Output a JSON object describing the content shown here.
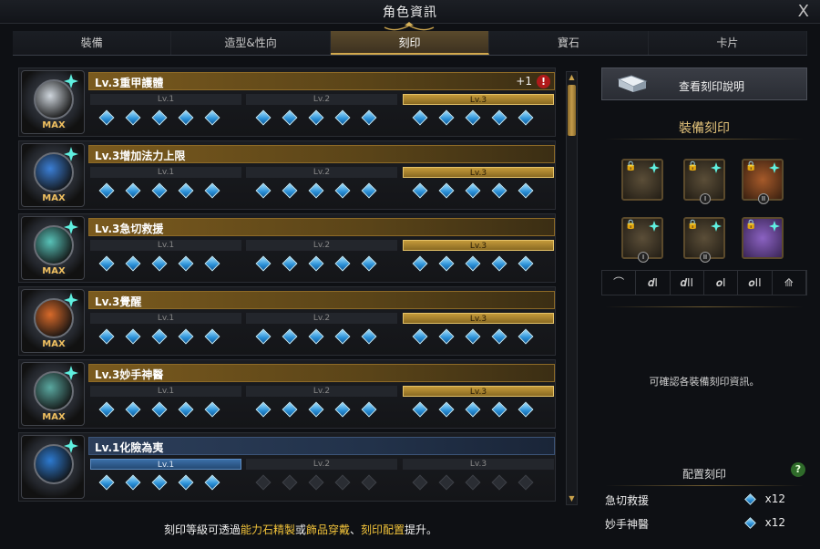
{
  "window": {
    "title": "角色資訊",
    "close": "X"
  },
  "tabs": [
    "裝備",
    "造型&性向",
    "刻印",
    "寶石",
    "卡片"
  ],
  "active_tab": 2,
  "engravings": [
    {
      "name": "Lv.3重甲護體",
      "badge": "MAX",
      "plus": "+1",
      "alert": "!",
      "level": 3,
      "style": "gold"
    },
    {
      "name": "Lv.3增加法力上限",
      "badge": "MAX",
      "level": 3,
      "style": "gold"
    },
    {
      "name": "Lv.3急切救援",
      "badge": "MAX",
      "level": 3,
      "style": "gold"
    },
    {
      "name": "Lv.3覺醒",
      "badge": "MAX",
      "level": 3,
      "style": "gold"
    },
    {
      "name": "Lv.3妙手神醫",
      "badge": "MAX",
      "level": 3,
      "style": "gold"
    },
    {
      "name": "Lv.1化險為夷",
      "badge": "",
      "level": 1,
      "style": "blue"
    }
  ],
  "level_labels": [
    "Lv.1",
    "Lv.2",
    "Lv.3"
  ],
  "footer": {
    "prefix": "刻印等級可透過",
    "h1": "能力石精製",
    "mid1": "或",
    "h2": "飾品穿戴",
    "mid2": "、",
    "h3": "刻印配置",
    "suffix": "提升。"
  },
  "right": {
    "view_button": "查看刻印說明",
    "equip_title": "裝備刻印",
    "tiers": [
      "",
      "I",
      "II",
      "I",
      "II",
      ""
    ],
    "categories": [
      "⌒",
      "𝒅I",
      "𝒅II",
      "𝒐I",
      "𝒐II",
      "⟰"
    ],
    "hint": "可確認各裝備刻印資訊。",
    "placement_title": "配置刻印",
    "help": "?",
    "placements": [
      {
        "name": "急切救援",
        "count": "x12"
      },
      {
        "name": "妙手神醫",
        "count": "x12"
      }
    ]
  },
  "colors": {
    "gold": "#c49a3a",
    "blue": "#3b6fa8",
    "accent": "#f2c33a"
  }
}
